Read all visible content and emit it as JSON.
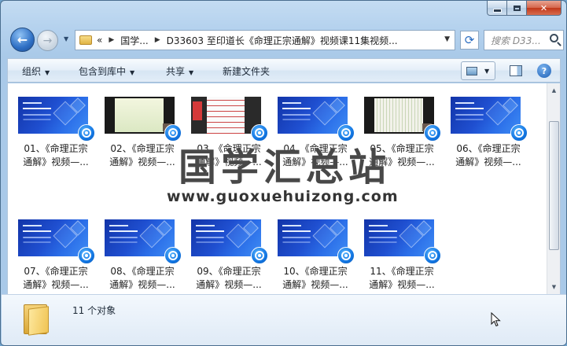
{
  "window": {
    "caption": {
      "minimize": "",
      "maximize": "",
      "close": "✕"
    }
  },
  "nav": {
    "back_glyph": "←",
    "forward_glyph": "→",
    "breadcrumb": [
      "«",
      "国学...",
      "D33603 至印道长《命理正宗通解》视频课11集视频..."
    ],
    "search_placeholder": "搜索 D33...",
    "refresh_glyph": "⟳"
  },
  "toolbar": {
    "organize": "组织",
    "include_in_library": "包含到库中",
    "share": "共享",
    "new_folder": "新建文件夹",
    "help": "?"
  },
  "files": [
    {
      "line1": "01、《命理正宗",
      "line2": "通解》视频—...",
      "thumb": "blue"
    },
    {
      "line1": "02、《命理正宗",
      "line2": "通解》视频—...",
      "thumb": "dark-green"
    },
    {
      "line1": "03、《命理正宗",
      "line2": "通解》视频—...",
      "thumb": "doc"
    },
    {
      "line1": "04、《命理正宗",
      "line2": "通解》视频—...",
      "thumb": "blue"
    },
    {
      "line1": "05、《命理正宗",
      "line2": "通解》视频—...",
      "thumb": "dark-paper"
    },
    {
      "line1": "06、《命理正宗",
      "line2": "通解》视频—...",
      "thumb": "blue"
    },
    {
      "line1": "07、《命理正宗",
      "line2": "通解》视频—...",
      "thumb": "blue"
    },
    {
      "line1": "08、《命理正宗",
      "line2": "通解》视频—...",
      "thumb": "blue"
    },
    {
      "line1": "09、《命理正宗",
      "line2": "通解》视频—...",
      "thumb": "blue"
    },
    {
      "line1": "10、《命理正宗",
      "line2": "通解》视频—...",
      "thumb": "blue"
    },
    {
      "line1": "11、《命理正宗",
      "line2": "通解》视频—...",
      "thumb": "blue"
    }
  ],
  "watermark": {
    "title": "国学汇总站",
    "url": "www.guoxuehuizong.com"
  },
  "status": {
    "count_text": "11 个对象"
  },
  "colors": {
    "accent": "#1f4fd0",
    "window_frame": "#b5d2ee",
    "close_red": "#c1381a"
  }
}
